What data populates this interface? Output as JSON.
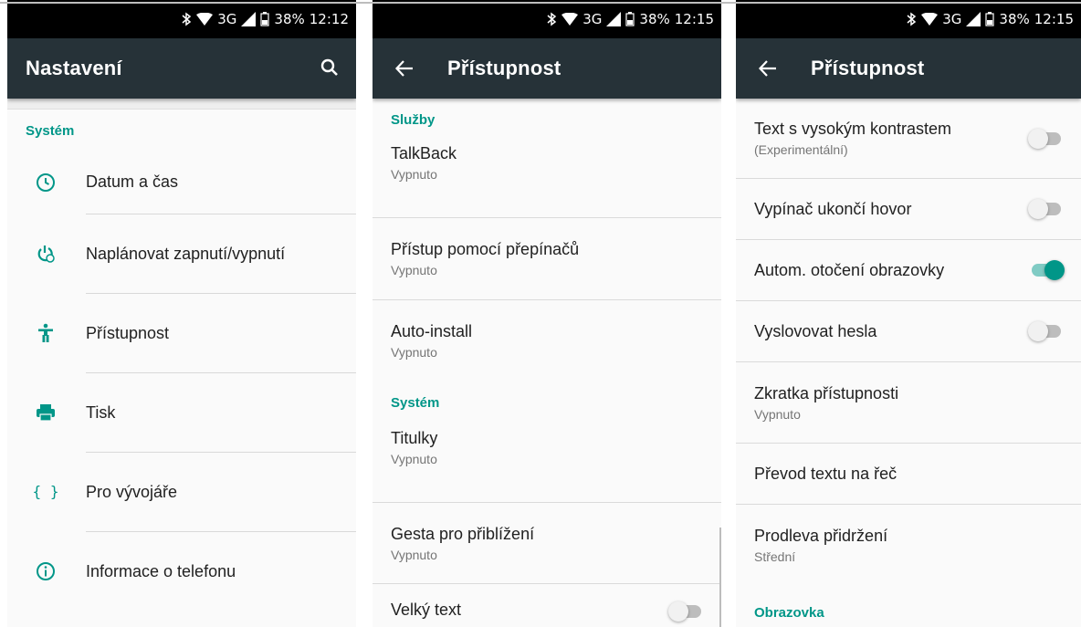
{
  "status": {
    "p1": {
      "battery": "38%",
      "time": "12:12",
      "network": "3G"
    },
    "p2": {
      "battery": "38%",
      "time": "12:15",
      "network": "3G"
    },
    "p3": {
      "battery": "38%",
      "time": "12:15",
      "network": "3G"
    }
  },
  "settings": {
    "title": "Nastavení",
    "section": "Systém",
    "items": [
      {
        "label": "Datum a čas",
        "icon": "clock-icon"
      },
      {
        "label": "Naplánovat zapnutí/vypnutí",
        "icon": "scheduled-power-icon"
      },
      {
        "label": "Přístupnost",
        "icon": "accessibility-icon"
      },
      {
        "label": "Tisk",
        "icon": "printer-icon"
      },
      {
        "label": "Pro vývojáře",
        "icon": "developer-braces-icon"
      },
      {
        "label": "Informace o telefonu",
        "icon": "info-icon"
      }
    ]
  },
  "access1": {
    "title": "Přístupnost",
    "section_services": "Služby",
    "section_system": "Systém",
    "items": [
      {
        "title": "TalkBack",
        "subtitle": "Vypnuto"
      },
      {
        "title": "Přístup pomocí přepínačů",
        "subtitle": "Vypnuto"
      },
      {
        "title": "Auto-install",
        "subtitle": "Vypnuto"
      },
      {
        "title": "Titulky",
        "subtitle": "Vypnuto"
      },
      {
        "title": "Gesta pro přiblížení",
        "subtitle": "Vypnuto"
      },
      {
        "title": "Velký text",
        "switch": false
      }
    ]
  },
  "access2": {
    "title": "Přístupnost",
    "items": [
      {
        "title": "Text s vysokým kontrastem",
        "subtitle": "(Experimentální)",
        "switch": false
      },
      {
        "title": "Vypínač ukončí hovor",
        "switch": false
      },
      {
        "title": "Autom. otočení obrazovky",
        "switch": true
      },
      {
        "title": "Vyslovovat hesla",
        "switch": false
      },
      {
        "title": "Zkratka přístupnosti",
        "subtitle": "Vypnuto"
      },
      {
        "title": "Převod textu na řeč"
      },
      {
        "title": "Prodleva přidržení",
        "subtitle": "Střední"
      }
    ],
    "section_display": "Obrazovka"
  },
  "colors": {
    "appbar": "#263238",
    "accent": "#009688",
    "statusbar": "#000000"
  }
}
